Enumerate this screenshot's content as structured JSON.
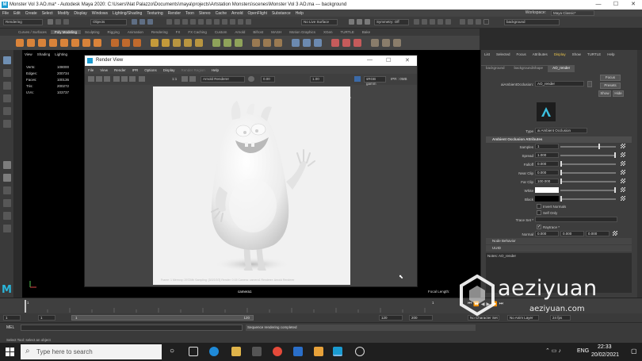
{
  "window": {
    "title": "Monster Vol 3 AO.ma* - Autodesk Maya 2020: C:\\Users\\Nat Palazzo\\Documents\\maya\\projects\\Artstation Monsters\\scenes\\Monster Vol 3 AO.ma  ---  background",
    "min": "—",
    "max": "☐",
    "close": "✕"
  },
  "menubar": {
    "items": [
      "File",
      "Edit",
      "Create",
      "Select",
      "Modify",
      "Display",
      "Windows",
      "Lighting/Shading",
      "Texturing",
      "Render",
      "Toon",
      "Stereo",
      "Cache",
      "Arnold",
      "OpenFlight",
      "Substance",
      "Help"
    ],
    "workspace_label": "Workspace:",
    "workspace_value": "Maya Classic*"
  },
  "statusline": {
    "mode": "Rendering",
    "objects": "Objects",
    "live_surface": "No Live Surface",
    "symmetry": "Symmetry: Off",
    "search": "background"
  },
  "shelf": {
    "tabs": [
      "Curves / Surfaces",
      "Poly Modeling",
      "Sculpting",
      "Rigging",
      "Animation",
      "Rendering",
      "FX",
      "FX Caching",
      "Custom",
      "Arnold",
      "Bifrost",
      "MASH",
      "Motion Graphics",
      "XGen",
      "TURTLE",
      "Bake"
    ],
    "active_index": 1
  },
  "viewport": {
    "menu": [
      "View",
      "Shading",
      "Lighting"
    ],
    "hud": [
      {
        "label": "Verts:",
        "value": "108000"
      },
      {
        "label": "Edges:",
        "value": "200734"
      },
      {
        "label": "Faces:",
        "value": "100136"
      },
      {
        "label": "Tris:",
        "value": "200272"
      },
      {
        "label": "UVs:",
        "value": "103737"
      }
    ],
    "camera": "camera1",
    "focal_length": "Focal Length:",
    "logo": "M"
  },
  "render_view": {
    "title": "Render View",
    "menu": [
      "File",
      "View",
      "Render",
      "IPR",
      "Options",
      "Display",
      "Render Region",
      "Help"
    ],
    "dim_index": 6,
    "renderer": "Arnold Renderer",
    "exposure": "0.00",
    "gamma": "1.00",
    "colorspace": "sRGB gamm",
    "ipr": "IPR : 0MB",
    "ratio": "1:1",
    "bottom_text": "Frame: 1   Memory: 2972Mb   Sampling: [3/2/2/2/2]   Render: 0:15   Camera: camera1   Renderer: Arnold Renderer"
  },
  "attribute_editor": {
    "menu": [
      "List",
      "Selected",
      "Focus",
      "Attributes",
      "Display",
      "Show",
      "TURTLE",
      "Help"
    ],
    "highlight_index": 4,
    "tabs": [
      "background",
      "backgroundShape",
      "AO_render"
    ],
    "active_tab": 2,
    "node_label": "aiAmbientOcclusion:",
    "node_name": "AO_render",
    "buttons": [
      "Focus",
      "Presets",
      "Show",
      "Hide"
    ],
    "type_label": "Type",
    "type_value": "ai Ambient Occlusion",
    "section_title": "Ambient Occlusion Attributes",
    "attrs": [
      {
        "label": "Samples",
        "value": "1"
      },
      {
        "label": "Spread",
        "value": "1.000"
      },
      {
        "label": "Falloff",
        "value": "0.000"
      },
      {
        "label": "Near Clip",
        "value": "0.000"
      },
      {
        "label": "Far Clip",
        "value": "100.000"
      },
      {
        "label": "White",
        "value": ""
      },
      {
        "label": "Black",
        "value": ""
      }
    ],
    "invert_normals": "Invert Normals",
    "self_only": "Self Only",
    "trace_set": "Trace Set *",
    "raytrace_value": "Raytrace *",
    "normal_label": "Normal",
    "normal_values": [
      "0.000",
      "0.000",
      "0.000"
    ],
    "collapsed_sections": [
      "Node Behavior",
      "UUID"
    ],
    "notes": "Notes:  AO_render"
  },
  "timeline": {
    "ticks": [
      "1",
      "5",
      "10",
      "15",
      "20",
      "25",
      "30",
      "35",
      "40",
      "45",
      "50",
      "55",
      "60",
      "65",
      "70",
      "75",
      "80",
      "85",
      "90",
      "95",
      "100",
      "105",
      "110",
      "115",
      "120"
    ],
    "current_frame": "1"
  },
  "range": {
    "start": "1",
    "start2": "1",
    "range_end": "120",
    "end": "120",
    "end2": "200",
    "character_set": "No Character Set",
    "anim_layer": "No Anim Layer",
    "fps": "24 fps"
  },
  "cmdline": {
    "lang": "MEL",
    "result": "Sequence rendering completed"
  },
  "helpline": {
    "text": "Select Tool: select an object"
  },
  "watermark": {
    "name": "aeziyuan",
    "url": "aeziyuan.com"
  },
  "taskbar": {
    "search_placeholder": "Type here to search",
    "lang": "ENG",
    "time": "22:33",
    "date": "20/02/2021"
  }
}
